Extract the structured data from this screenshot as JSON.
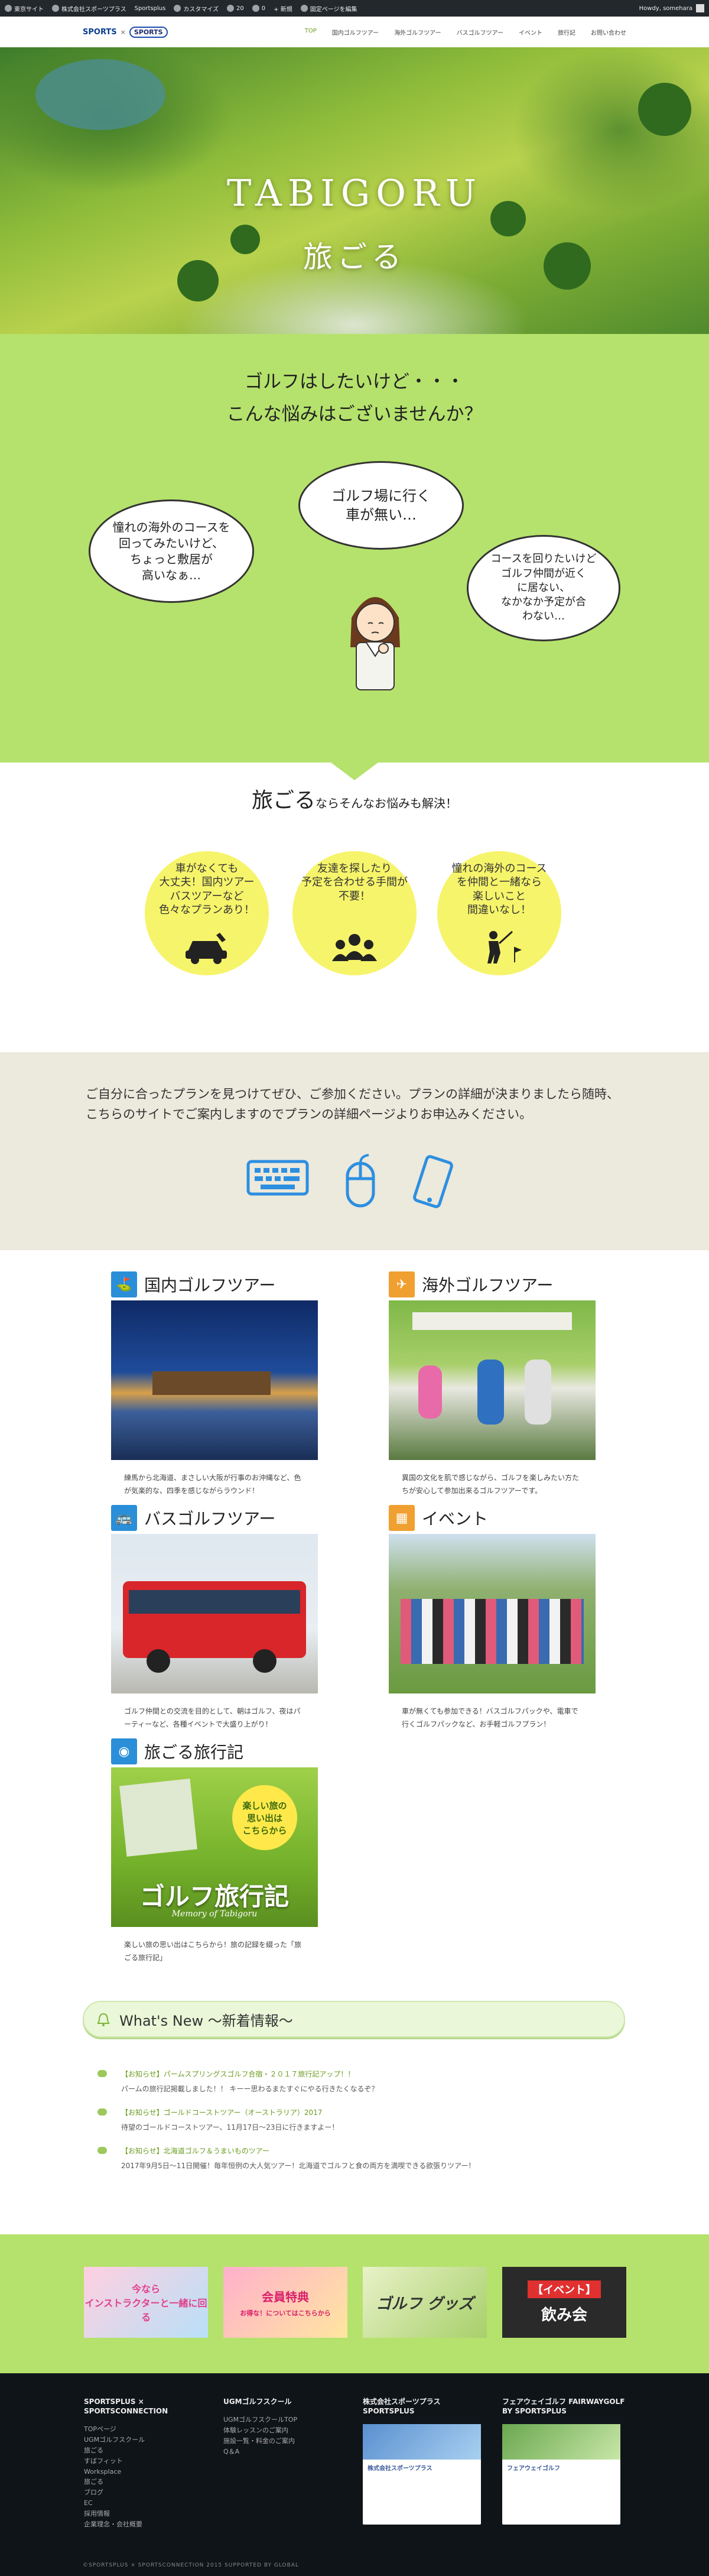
{
  "admin_bar": {
    "items": [
      "東京サイト",
      "株式会社スポーツプラス",
      "Sportsplus",
      "カスタマイズ",
      "20",
      "0",
      "+ 新規",
      "固定ページを編集"
    ],
    "howdy": "Howdy, somehara"
  },
  "header": {
    "logo_sports": "SPORTS",
    "logo_x": "×",
    "logo_sc": "SPORTS",
    "nav": [
      "TOP",
      "国内ゴルフツアー",
      "海外ゴルフツアー",
      "バスゴルフツアー",
      "イベント",
      "旅行記",
      "お問い合わせ"
    ]
  },
  "hero": {
    "title": "TABIGORU",
    "subtitle": "旅ごる"
  },
  "worries": {
    "line1": "ゴルフはしたいけど・・・",
    "line2": "こんな悩みはございませんか？",
    "bubble_left": "憧れの海外のコースを\n回ってみたいけど、\nちょっと敷居が\n高いなぁ…",
    "bubble_center": "ゴルフ場に行く\n車が無い…",
    "bubble_right": "コースを回りたいけど\nゴルフ仲間が近く\nに居ない、\nなかなか予定が合\nわない…"
  },
  "solution": {
    "big": "旅ごる",
    "small": "ならそんなお悩みも解決！",
    "circles": [
      {
        "text": "車がなくても\n大丈夫！国内ツアー\nバスツアーなど\n色々なプランあり！",
        "icon": "car-icon"
      },
      {
        "text": "友達を探したり\n予定を合わせる手間が\n不要！",
        "icon": "people-icon"
      },
      {
        "text": "憧れの海外のコース\nを仲間と一緒なら\n楽しいこと\n間違いなし！",
        "icon": "golfer-icon"
      }
    ]
  },
  "plan": {
    "text": "ご自分に合ったプランを見つけてぜひ、ご参加ください。プランの詳細が決まりましたら随時、こちらのサイトでご案内しますのでプランの詳細ページよりお申込みください。",
    "icons": [
      "keyboard-icon",
      "mouse-icon",
      "smartphone-icon"
    ]
  },
  "tours": [
    {
      "title": "国内ゴルフツアー",
      "icon": "golf-flag-icon",
      "color": "#2a8fd8",
      "desc": "練馬から北海道、まさしい大阪が行事のお沖縄など、色が気楽的な、四季を感じながらラウンド！"
    },
    {
      "title": "海外ゴルフツアー",
      "icon": "airplane-icon",
      "color": "#f0a030",
      "desc": "異国の文化を肌で感じながら、ゴルフを楽しみたい方たちが安心して参加出来るゴルフツアーです。"
    },
    {
      "title": "バスゴルフツアー",
      "icon": "bus-icon",
      "color": "#2a8fd8",
      "desc": "ゴルフ仲間との交流を目的として、朝はゴルフ、夜はパーティーなど、各種イベントで大盛り上がり！"
    },
    {
      "title": "イベント",
      "icon": "calendar-icon",
      "color": "#f0a030",
      "desc": "車が無くても参加できる！バスゴルフパックや、電車で行くゴルフパックなど、お手軽ゴルフプラン！"
    },
    {
      "title": "旅ごる旅行記",
      "icon": "camera-icon",
      "color": "#2a8fd8",
      "desc": "楽しい旅の思い出はこちらから！旅の記録を綴った「旅ごる旅行記」",
      "banner_text": "ゴルフ旅行記",
      "banner_sub": "Memory of Tabigoru",
      "banner_badge": "楽しい旅の\n思い出は\nこちらから"
    }
  ],
  "news": {
    "heading": "What's New ～新着情報～",
    "items": [
      {
        "title": "【お知らせ】パームスプリングスゴルフ合宿・２０１７旅行記アップ！！",
        "body": "パームの旅行記掲載しました！！ キーー思わるまたすぐにやる行きたくなるぞ？"
      },
      {
        "title": "【お知らせ】ゴールドコーストツアー（オーストラリア）2017",
        "body": "待望のゴールドコーストツアー、11月17日〜23日に行きますよー！"
      },
      {
        "title": "【お知らせ】北海道ゴルフ＆うまいものツアー",
        "body": "2017年9月5日〜11日開催！毎年恒例の大人気ツアー！北海道でゴルフと食の両方を満喫できる欲張りツアー！"
      }
    ]
  },
  "banners": [
    {
      "text": "インストラクターと一緒に回る",
      "sub": "今なら",
      "bg": "#ffd0e0"
    },
    {
      "text": "会員特典",
      "sub": "お得な！についてはこちらから",
      "bg": "#ffb0cc"
    },
    {
      "text": "ゴルフ グッズ",
      "sub": "",
      "bg": "#cfe8a8"
    },
    {
      "text": "【イベント】",
      "sub": "飲み会",
      "bg": "#3a3a3a"
    }
  ],
  "footer": {
    "col1_title": "SPORTSPLUS × SPORTSCONNECTION",
    "col1_links": [
      "TOPページ",
      "UGMゴルフスクール",
      "旅ごる",
      "すばフィット",
      "Worksplace",
      "旅ごる",
      "ブログ",
      "EC",
      "採用情報",
      "企業理念・会社概要"
    ],
    "col2_title": "UGMゴルフスクール",
    "col2_links": [
      "UGMゴルフスクールTOP",
      "体験レッスンのご案内",
      "施設一覧・料金のご案内",
      "Q＆A"
    ],
    "col3_title": "株式会社スポーツプラス SPORTSPLUS",
    "col4_title": "フェアウェイゴルフ FAIRWAYGOLF BY SPORTSPLUS",
    "fb_name": "株式会社スポーツプラス",
    "fb_name2": "フェアウェイゴルフ",
    "copyright": "©SPORTSPLUS × SPORTSCONNECTION 2015 SUPPORTED BY GLOBAL"
  }
}
